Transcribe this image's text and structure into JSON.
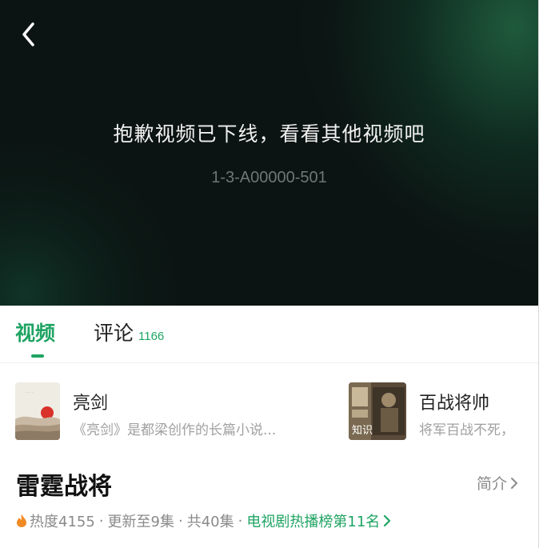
{
  "player": {
    "message": "抱歉视频已下线，看看其他视频吧",
    "error_code": "1-3-A00000-501",
    "back_icon": "chevron-left-icon"
  },
  "tabs": [
    {
      "label": "视频",
      "active": true
    },
    {
      "label": "评论",
      "count": "1166",
      "active": false
    }
  ],
  "related": [
    {
      "title": "亮剑",
      "desc": "《亮剑》是都梁创作的长篇小说...",
      "tag": ""
    },
    {
      "title": "百战将帅",
      "desc": "将军百战不死，",
      "tag": "知识"
    }
  ],
  "show": {
    "title": "雷霆战将",
    "intro_label": "简介",
    "heat": "热度4155",
    "update": "更新至9集",
    "total": "共40集",
    "rank": "电视剧热播榜第11名"
  },
  "colors": {
    "accent": "#1fa463",
    "player_bg": "#0c1513",
    "flame": "#f08a24"
  }
}
